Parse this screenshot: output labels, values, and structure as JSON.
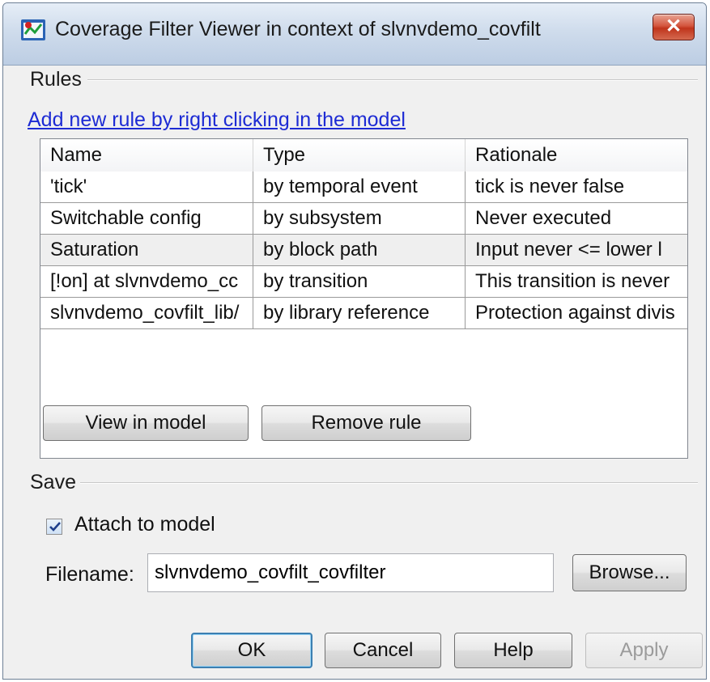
{
  "window": {
    "title": "Coverage Filter Viewer in context of slvnvdemo_covfilt",
    "close_label": "✕"
  },
  "rules": {
    "group_label": "Rules",
    "add_link": "Add new rule by right clicking in the model",
    "columns": [
      "Name",
      "Type",
      "Rationale"
    ],
    "rows": [
      [
        "'tick'",
        "by temporal event",
        "tick is never false"
      ],
      [
        "Switchable config",
        "by subsystem",
        "Never executed"
      ],
      [
        "Saturation",
        "by block path",
        "Input never <= lower l"
      ],
      [
        "[!on] at slvnvdemo_cc",
        "by transition",
        "This transition is never"
      ],
      [
        "slvnvdemo_covfilt_lib/",
        "by library reference",
        "Protection against divis"
      ]
    ],
    "view_in_model": "View in model",
    "remove_rule": "Remove rule"
  },
  "save": {
    "group_label": "Save",
    "attach_label": "Attach to model",
    "attach_checked": true,
    "filename_label": "Filename:",
    "filename_value": "slvnvdemo_covfilt_covfilter",
    "browse": "Browse..."
  },
  "footer": {
    "ok": "OK",
    "cancel": "Cancel",
    "help": "Help",
    "apply": "Apply"
  }
}
